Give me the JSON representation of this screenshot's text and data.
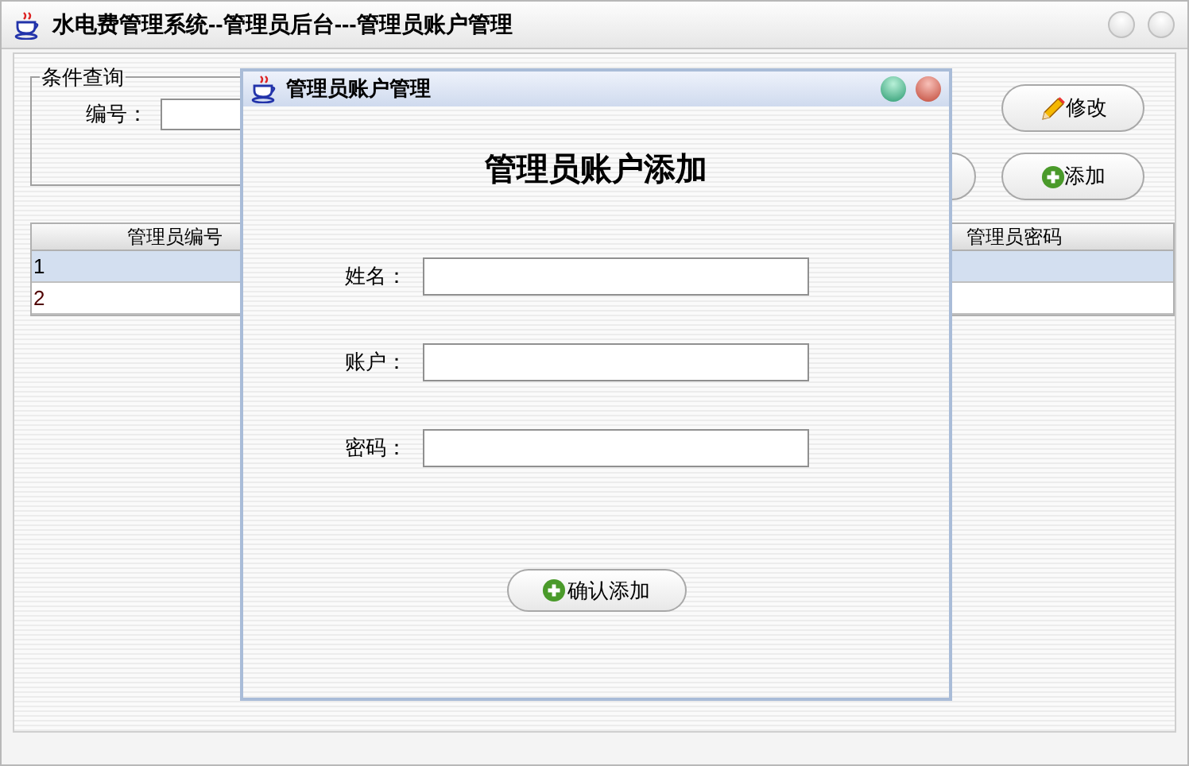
{
  "window": {
    "title": "水电费管理系统--管理员后台---管理员账户管理"
  },
  "query_group": {
    "legend": "条件查询",
    "fields": [
      {
        "label": "编号："
      }
    ]
  },
  "buttons": [
    {
      "kind": "edit",
      "label": "修改"
    },
    {
      "kind": "plain"
    },
    {
      "kind": "add",
      "label": "添加"
    }
  ],
  "table": {
    "columns": [
      "管理员编号",
      "管理员密码"
    ],
    "rows": [
      {
        "cells": [
          "1"
        ],
        "selected": true
      },
      {
        "cells": [
          "2"
        ],
        "selected": false
      }
    ]
  },
  "dialog": {
    "title": "管理员账户管理",
    "heading": "管理员账户添加",
    "fields": [
      {
        "label": "姓名："
      },
      {
        "label": "账户："
      },
      {
        "label": "密码："
      }
    ],
    "submit": "确认添加"
  }
}
